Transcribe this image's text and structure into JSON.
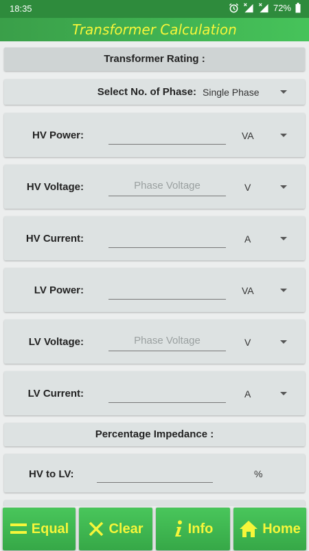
{
  "status": {
    "time": "18:35",
    "battery": "72%",
    "icons": [
      "alarm-icon",
      "signal-icon",
      "signal-icon",
      "battery-icon"
    ]
  },
  "app": {
    "title": "Transformer Calculation"
  },
  "transformer_rating": {
    "header": "Transformer Rating :",
    "phase_label": "Select No. of Phase:",
    "phase_value": "Single Phase"
  },
  "fields": [
    {
      "label": "HV Power:",
      "value": "",
      "placeholder": "",
      "unit": "VA"
    },
    {
      "label": "HV Voltage:",
      "value": "",
      "placeholder": "Phase Voltage",
      "unit": "V"
    },
    {
      "label": "HV Current:",
      "value": "",
      "placeholder": "",
      "unit": "A"
    },
    {
      "label": "LV Power:",
      "value": "",
      "placeholder": "",
      "unit": "VA"
    },
    {
      "label": "LV Voltage:",
      "value": "",
      "placeholder": "Phase Voltage",
      "unit": "V"
    },
    {
      "label": "LV Current:",
      "value": "",
      "placeholder": "",
      "unit": "A"
    }
  ],
  "impedance": {
    "header": "Percentage Impedance :",
    "label": "HV to LV:",
    "value": "",
    "unit": "%"
  },
  "buttons": {
    "equal": "Equal",
    "clear": "Clear",
    "info": "Info",
    "home": "Home"
  },
  "colors": {
    "status_bar": "#2e8b3c",
    "title_bar": "#46c35a",
    "title_text": "#f6f63a",
    "button_bg": "#45bf57",
    "button_text": "#f6f63a",
    "card_bg": "#dde2e2"
  }
}
